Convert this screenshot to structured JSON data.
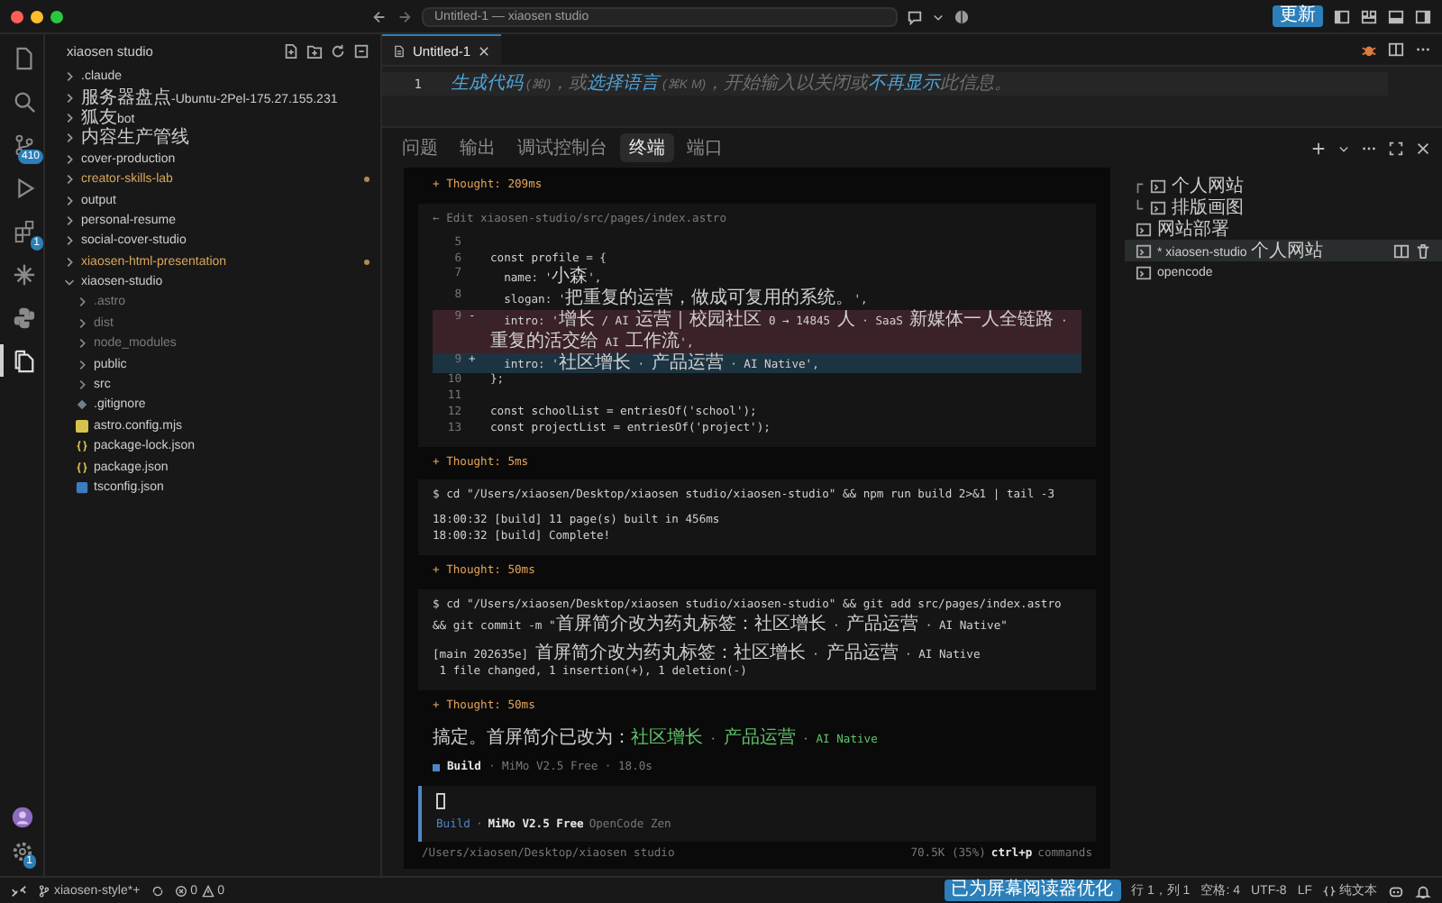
{
  "window": {
    "title": "Untitled-1 — xiaosen studio",
    "update_button": "更新"
  },
  "activity_bar": {
    "items": [
      {
        "selected": false
      },
      {
        "selected": false
      },
      {
        "selected": false,
        "badge": "410"
      },
      {
        "selected": false
      },
      {
        "selected": false,
        "badge": "1"
      },
      {
        "selected": false
      },
      {
        "selected": false
      },
      {
        "selected": true
      }
    ],
    "settings_badge": "1"
  },
  "explorer": {
    "title": "xiaosen studio",
    "items": [
      {
        "label": ".claude",
        "kind": "folder",
        "expanded": false,
        "modified": false,
        "ignored": false
      },
      {
        "label": "服务器盘点-Ubuntu-2Pel-175.27.155.231",
        "kind": "folder",
        "expanded": false,
        "modified": false,
        "ignored": false
      },
      {
        "label": "狐友bot",
        "kind": "folder",
        "expanded": false,
        "modified": false,
        "ignored": false
      },
      {
        "label": "内容生产管线",
        "kind": "folder",
        "expanded": false,
        "modified": false,
        "ignored": false
      },
      {
        "label": "cover-production",
        "kind": "folder",
        "expanded": false,
        "modified": false,
        "ignored": false
      },
      {
        "label": "creator-skills-lab",
        "kind": "folder",
        "expanded": false,
        "modified": true,
        "ignored": false
      },
      {
        "label": "output",
        "kind": "folder",
        "expanded": false,
        "modified": false,
        "ignored": false
      },
      {
        "label": "personal-resume",
        "kind": "folder",
        "expanded": false,
        "modified": false,
        "ignored": false
      },
      {
        "label": "social-cover-studio",
        "kind": "folder",
        "expanded": false,
        "modified": false,
        "ignored": false
      },
      {
        "label": "xiaosen-html-presentation",
        "kind": "folder",
        "expanded": false,
        "modified": true,
        "ignored": false
      },
      {
        "label": "xiaosen-studio",
        "kind": "folder",
        "expanded": true,
        "modified": false,
        "ignored": false,
        "children": [
          {
            "label": ".astro",
            "kind": "folder",
            "expanded": false,
            "modified": false,
            "ignored": true
          },
          {
            "label": "dist",
            "kind": "folder",
            "expanded": false,
            "modified": false,
            "ignored": true
          },
          {
            "label": "node_modules",
            "kind": "folder",
            "expanded": false,
            "modified": false,
            "ignored": true
          },
          {
            "label": "public",
            "kind": "folder",
            "expanded": false,
            "modified": false,
            "ignored": false
          },
          {
            "label": "src",
            "kind": "folder",
            "expanded": false,
            "modified": false,
            "ignored": false
          },
          {
            "label": ".gitignore",
            "kind": "config",
            "modified": false,
            "ignored": false
          },
          {
            "label": "astro.config.mjs",
            "kind": "js",
            "modified": false,
            "ignored": false
          },
          {
            "label": "package-lock.json",
            "kind": "json",
            "modified": false,
            "ignored": false
          },
          {
            "label": "package.json",
            "kind": "json",
            "modified": false,
            "ignored": false
          },
          {
            "label": "tsconfig.json",
            "kind": "ts",
            "modified": false,
            "ignored": false
          }
        ]
      }
    ]
  },
  "editor": {
    "tabs": [
      {
        "label": "Untitled-1",
        "selected": true
      }
    ],
    "line_number": "1",
    "hint": [
      {
        "text": "生成代码",
        "link": true
      },
      {
        "text": " (⌘I)，或",
        "link": false
      },
      {
        "text": "选择语言",
        "link": true
      },
      {
        "text": " (⌘K M)，开始输入以关闭或",
        "link": false
      },
      {
        "text": "不再显示",
        "link": true
      },
      {
        "text": "此信息。",
        "link": false
      }
    ]
  },
  "panel": {
    "tabs": [
      {
        "label": "问题",
        "selected": false
      },
      {
        "label": "输出",
        "selected": false
      },
      {
        "label": "调试控制台",
        "selected": false
      },
      {
        "label": "终端",
        "selected": true
      },
      {
        "label": "端口",
        "selected": false
      }
    ],
    "terminal": {
      "blocks": [
        {
          "kind": "thought",
          "text": "+ Thought: 209ms"
        },
        {
          "kind": "edit",
          "title": "← Edit xiaosen-studio/src/pages/index.astro",
          "lines": [
            {
              "num": "5",
              "removed": false,
              "added": false
            },
            {
              "num": "6",
              "removed": false,
              "added": false,
              "code": "const profile = {"
            },
            {
              "num": "7",
              "removed": false,
              "added": false,
              "code": "  name: '小森',"
            },
            {
              "num": "8",
              "removed": false,
              "added": false,
              "code": "  slogan: '把重复的运营，做成可复用的系统。',"
            },
            {
              "num": "9",
              "sign": "-",
              "removed": true,
              "added": false,
              "code": "  intro: '增长 / AI 运营｜校园社区 0 → 14845 人 · SaaS 新媒体一人全链路 · 重复的活交给 AI 工作流',"
            },
            {
              "num": "9",
              "sign": "+",
              "removed": false,
              "added": true,
              "code": "  intro: '社区增长 · 产品运营 · AI Native',"
            },
            {
              "num": "10",
              "removed": false,
              "added": false,
              "code": "};"
            },
            {
              "num": "11",
              "removed": false,
              "added": false
            },
            {
              "num": "12",
              "removed": false,
              "added": false,
              "code": "const schoolList = entriesOf('school');"
            },
            {
              "num": "13",
              "removed": false,
              "added": false,
              "code": "const projectList = entriesOf('project');"
            }
          ]
        },
        {
          "kind": "thought",
          "text": "+ Thought: 5ms"
        },
        {
          "kind": "command",
          "command": "$ cd \"/Users/xiaosen/Desktop/xiaosen studio/xiaosen-studio\" && npm run build 2>&1 | tail -3",
          "output": [
            "18:00:32 [build] 11 page(s) built in 456ms",
            "18:00:32 [build] Complete!"
          ]
        },
        {
          "kind": "thought",
          "text": "+ Thought: 50ms"
        },
        {
          "kind": "command",
          "command": "$ cd \"/Users/xiaosen/Desktop/xiaosen studio/xiaosen-studio\" && git add src/pages/index.astro && git commit -m \"首屏简介改为药丸标签：社区增长 · 产品运营 · AI Native\"",
          "output": [
            "[main 202635e] 首屏简介改为药丸标签：社区增长 · 产品运营 · AI Native",
            " 1 file changed, 1 insertion(+), 1 deletion(-)"
          ]
        },
        {
          "kind": "thought",
          "text": "+ Thought: 50ms"
        },
        {
          "kind": "message",
          "text": "搞定。首屏简介已改为：",
          "highlight": "社区增长 · 产品运营 · AI Native"
        },
        {
          "kind": "status",
          "agent": "Build",
          "detail": "· MiMo V2.5 Free · 18.0s"
        }
      ],
      "prompt": {
        "agent": "Build",
        "separator": "·",
        "model": "MiMo V2.5 Free",
        "provider": "OpenCode Zen"
      },
      "footer": {
        "path": "/Users/xiaosen/Desktop/xiaosen studio",
        "context": "70.5K (35%)",
        "shortcut_key": "ctrl+p",
        "shortcut_label": "commands"
      }
    },
    "sessions": [
      {
        "label": "个人网站",
        "kind": "split-top",
        "selected": false
      },
      {
        "label": "排版画图",
        "kind": "split-bottom",
        "selected": false
      },
      {
        "label": "网站部署",
        "kind": "single",
        "selected": false
      },
      {
        "label": "* xiaosen-studio 个人网站",
        "kind": "single",
        "selected": true
      },
      {
        "label": "opencode",
        "kind": "single",
        "selected": false
      }
    ]
  },
  "status_bar": {
    "branch": "xiaosen-style*+",
    "errors": "0",
    "warnings": "0",
    "screen_reader": "已为屏幕阅读器优化",
    "position": "行 1，列 1",
    "indent": "空格: 4",
    "encoding": "UTF-8",
    "eol": "LF",
    "language": "纯文本"
  }
}
